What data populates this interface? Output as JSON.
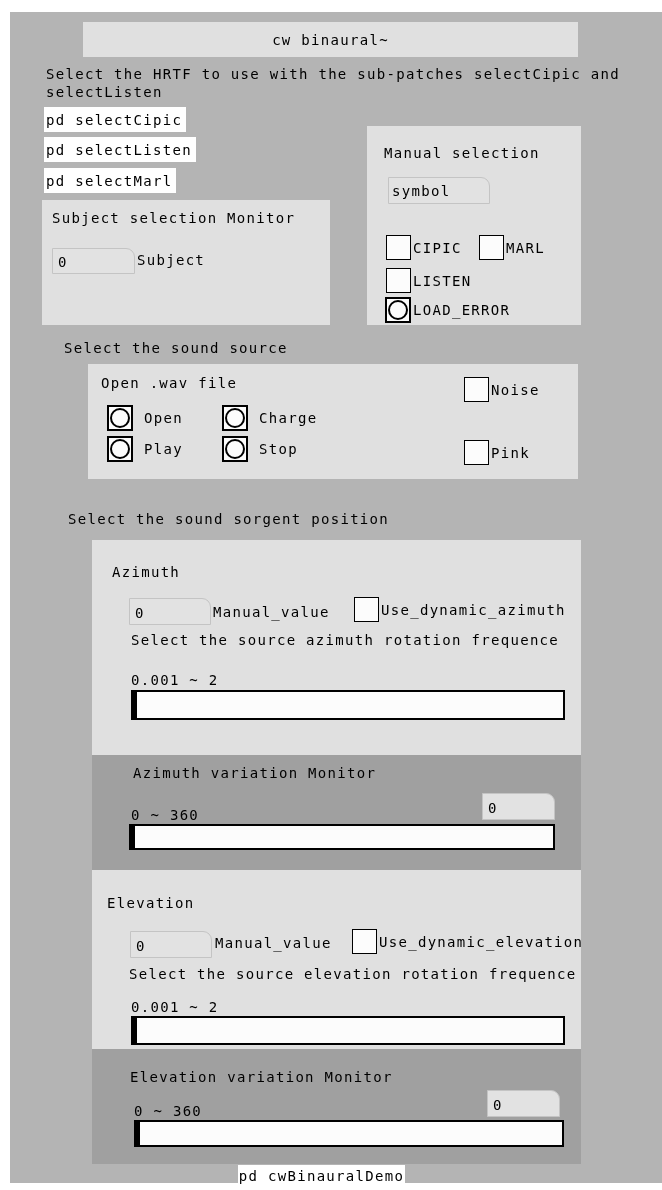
{
  "title": "cw binaural~",
  "intro": "Select the HRTF to use with the sub-patches selectCipic and selectListen",
  "subpatches": [
    {
      "label": "pd selectCipic"
    },
    {
      "label": "pd selectListen"
    },
    {
      "label": "pd selectMarl"
    }
  ],
  "subject_monitor": {
    "title": "Subject selection Monitor",
    "number": "0",
    "label": "Subject"
  },
  "manual_selection": {
    "title": "Manual selection",
    "symbol": "symbol",
    "controls": [
      {
        "kind": "toggle",
        "label": "CIPIC",
        "checked": false
      },
      {
        "kind": "toggle",
        "label": "MARL",
        "checked": false
      },
      {
        "kind": "toggle",
        "label": "LISTEN",
        "checked": false
      },
      {
        "kind": "bang",
        "label": "LOAD_ERROR"
      }
    ]
  },
  "source_heading": "Select the sound source",
  "source": {
    "title": "Open .wav file",
    "controls": [
      {
        "kind": "bang",
        "label": "Open"
      },
      {
        "kind": "bang",
        "label": "Charge"
      },
      {
        "kind": "bang",
        "label": "Play"
      },
      {
        "kind": "bang",
        "label": "Stop"
      },
      {
        "kind": "toggle",
        "label": "Noise",
        "checked": false
      },
      {
        "kind": "toggle",
        "label": "Pink",
        "checked": false
      }
    ]
  },
  "position_heading": "Select the sound sorgent position",
  "axes": [
    {
      "title": "Azimuth",
      "number": "0",
      "number_label": "Manual_value",
      "toggle_label": "Use_dynamic_azimuth",
      "checked": false,
      "description": "Select the source azimuth rotation frequence",
      "range": "0.001 ~ 2",
      "level": 0,
      "monitor": {
        "title": "Azimuth variation Monitor",
        "range": "0 ~ 360",
        "number": "0",
        "level": 0
      }
    },
    {
      "title": "Elevation",
      "number": "0",
      "number_label": "Manual_value",
      "toggle_label": "Use_dynamic_elevation",
      "checked": false,
      "description": "Select the source elevation rotation frequence",
      "range": "0.001 ~ 2",
      "level": 0,
      "monitor": {
        "title": "Elevation variation Monitor",
        "range": "0 ~ 360",
        "number": "0",
        "level": 0
      }
    }
  ],
  "footer": "pd cwBinauralDemo"
}
